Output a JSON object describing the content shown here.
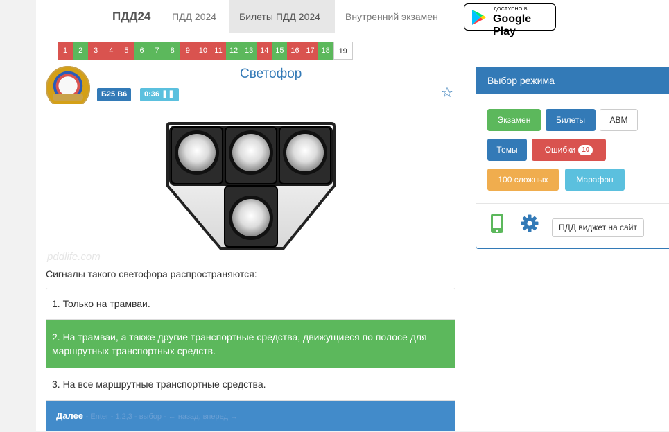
{
  "nav": {
    "brand": "ПДД24",
    "links": [
      "ПДД 2024",
      "Билеты ПДД 2024",
      "Внутренний экзамен"
    ],
    "google_play_small": "ДОСТУПНО В",
    "google_play_big": "Google Play"
  },
  "ticket_numbers": [
    {
      "n": "1",
      "state": "wrong"
    },
    {
      "n": "2",
      "state": "correct"
    },
    {
      "n": "3",
      "state": "wrong"
    },
    {
      "n": "4",
      "state": "wrong"
    },
    {
      "n": "5",
      "state": "wrong"
    },
    {
      "n": "6",
      "state": "correct"
    },
    {
      "n": "7",
      "state": "correct"
    },
    {
      "n": "8",
      "state": "correct"
    },
    {
      "n": "9",
      "state": "wrong"
    },
    {
      "n": "10",
      "state": "wrong"
    },
    {
      "n": "11",
      "state": "wrong"
    },
    {
      "n": "12",
      "state": "correct"
    },
    {
      "n": "13",
      "state": "correct"
    },
    {
      "n": "14",
      "state": "wrong"
    },
    {
      "n": "15",
      "state": "correct"
    },
    {
      "n": "16",
      "state": "wrong"
    },
    {
      "n": "17",
      "state": "wrong"
    },
    {
      "n": "18",
      "state": "correct"
    },
    {
      "n": "19",
      "state": "current"
    }
  ],
  "question": {
    "ticket_badge": "Б25 В6",
    "timer": "0:36",
    "title": "Светофор",
    "watermark": "pddlife.com",
    "text": "Сигналы такого светофора распространяются:",
    "answers": [
      "1. Только на трамваи.",
      "2. На трамваи, а также другие транспортные средства, движущиеся по полосе для маршрутных транспортных средств.",
      "3. На все маршрутные транспортные средства."
    ],
    "correct_answer_index": 1,
    "next_label": "Далее",
    "hint": "- Enter - 1,2,3 - выбор - ← назад, вперед →"
  },
  "mode_panel": {
    "title": "Выбор режима",
    "buttons": {
      "exam": "Экзамен",
      "tickets": "Билеты",
      "abm": "ABM",
      "topics": "Темы",
      "errors": "Ошибки",
      "errors_count": "10",
      "hard": "100 сложных",
      "marathon": "Марафон"
    },
    "widget_label": "ПДД виджет на сайт"
  },
  "colors": {
    "primary": "#337ab7",
    "success": "#5cb85c",
    "danger": "#d9534f",
    "warning": "#f0ad4e",
    "info": "#5bc0de"
  }
}
